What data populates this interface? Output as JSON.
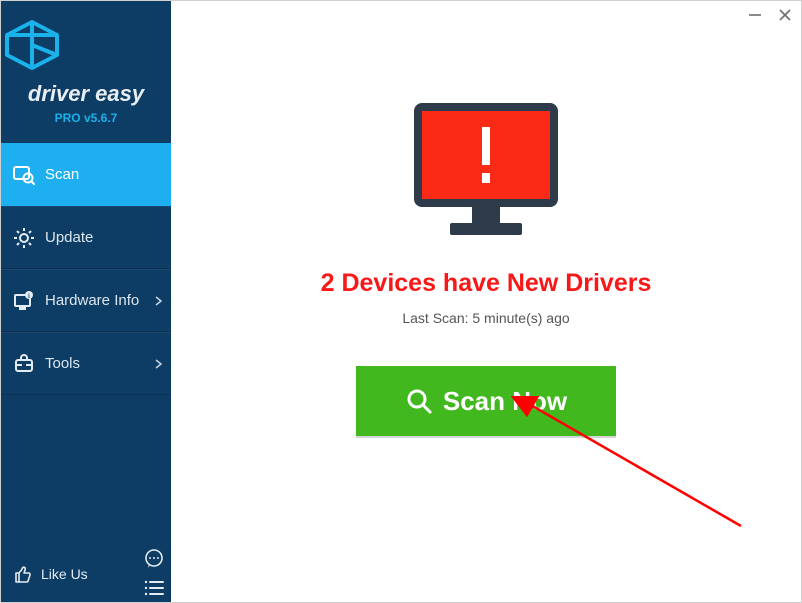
{
  "brand": "driver easy",
  "version": "PRO v5.6.7",
  "nav": {
    "scan": "Scan",
    "update": "Update",
    "hardware": "Hardware Info",
    "tools": "Tools"
  },
  "bottom": {
    "like": "Like Us"
  },
  "status_title": "2 Devices have New Drivers",
  "last_scan": "Last Scan: 5 minute(s) ago",
  "scan_btn": "Scan Now"
}
